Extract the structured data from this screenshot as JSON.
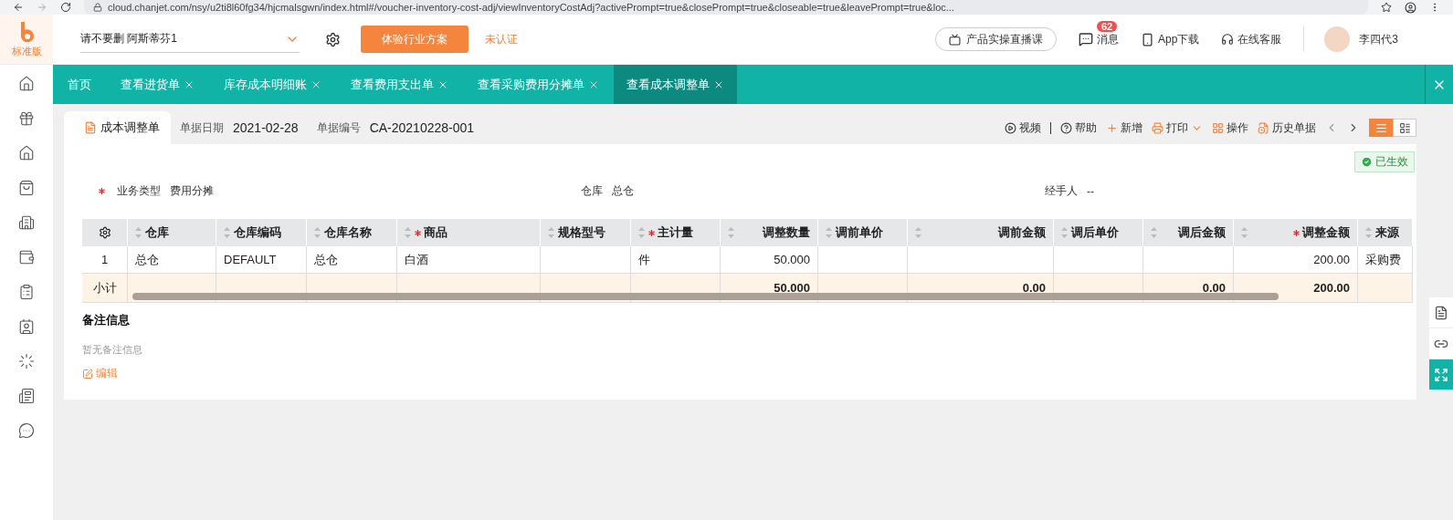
{
  "browser": {
    "url": "cloud.chanjet.com/nsy/u2ti8l60fg34/hjcmalsgwn/index.html#/voucher-inventory-cost-adj/viewInventoryCostAdj?activePrompt=true&closePrompt=true&closeable=true&leavePrompt=true&loc..."
  },
  "header": {
    "edition": "标准版",
    "company": "请不要删 阿斯蒂芬1",
    "trial_button": "体验行业方案",
    "cert_status": "未认证",
    "live_course": "产品实操直播课",
    "messages": {
      "label": "消息",
      "badge": "62"
    },
    "app_download": "App下载",
    "service": "在线客服",
    "user": "李四代3"
  },
  "tabs": [
    {
      "label": "首页",
      "selected": false,
      "closable": false
    },
    {
      "label": "查看进货单",
      "selected": false,
      "closable": true
    },
    {
      "label": "库存成本明细账",
      "selected": false,
      "closable": true
    },
    {
      "label": "查看费用支出单",
      "selected": false,
      "closable": true
    },
    {
      "label": "查看采购费用分摊单",
      "selected": false,
      "closable": true
    },
    {
      "label": "查看成本调整单",
      "selected": true,
      "closable": true
    }
  ],
  "doc": {
    "title": "成本调整单",
    "date_label": "单据日期",
    "date": "2021-02-28",
    "number_label": "单据编号",
    "number": "CA-20210228-001",
    "toolbar": [
      {
        "label": "视频",
        "kind": "plain"
      },
      {
        "label": "帮助",
        "kind": "plain"
      },
      {
        "label": "新增",
        "kind": "accent"
      },
      {
        "label": "打印",
        "kind": "menu"
      },
      {
        "label": "操作",
        "kind": "accent"
      },
      {
        "label": "历史单据",
        "kind": "accent"
      }
    ],
    "views": [
      {
        "selected": true
      },
      {
        "selected": false
      }
    ],
    "status": "已生效"
  },
  "fields": [
    {
      "label": "业务类型",
      "value": "费用分摊",
      "required": true
    },
    {
      "label": "仓库",
      "value": "总仓",
      "required": false
    },
    {
      "label": "经手人",
      "value": "--",
      "required": false
    }
  ],
  "table": {
    "columns": [
      {
        "label": "仓库",
        "required": false,
        "numeric": false
      },
      {
        "label": "仓库编码",
        "required": false,
        "numeric": false
      },
      {
        "label": "仓库名称",
        "required": false,
        "numeric": false
      },
      {
        "label": "商品",
        "required": true,
        "numeric": false
      },
      {
        "label": "规格型号",
        "required": false,
        "numeric": false
      },
      {
        "label": "主计量",
        "required": true,
        "numeric": false
      },
      {
        "label": "调整数量",
        "required": false,
        "numeric": true
      },
      {
        "label": "调前单价",
        "required": false,
        "numeric": false
      },
      {
        "label": "调前金额",
        "required": false,
        "numeric": true
      },
      {
        "label": "调后单价",
        "required": false,
        "numeric": false
      },
      {
        "label": "调后金额",
        "required": false,
        "numeric": true
      },
      {
        "label": "调整金额",
        "required": true,
        "numeric": true
      },
      {
        "label": "来源",
        "required": false,
        "numeric": false
      }
    ],
    "rows": [
      {
        "index": "1",
        "cells": [
          "总仓",
          "DEFAULT",
          "总仓",
          "白酒",
          "",
          "件",
          "50.000",
          "",
          "",
          "",
          "",
          "200.00",
          "采购费"
        ]
      }
    ],
    "subtotal": {
      "label": "小计",
      "cells": [
        "",
        "",
        "",
        "",
        "",
        "",
        "50.000",
        "",
        "0.00",
        "",
        "0.00",
        "200.00",
        ""
      ]
    }
  },
  "notes": {
    "title": "备注信息",
    "empty": "暂无备注信息",
    "edit": "编辑"
  }
}
